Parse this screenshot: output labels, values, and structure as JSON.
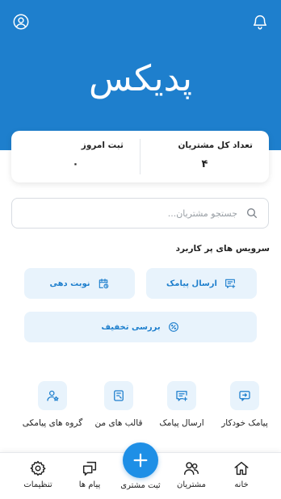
{
  "colors": {
    "primary": "#1e7fcd",
    "accent_bg": "#e8f3fc",
    "fab": "#1e8fe6"
  },
  "header": {
    "brand": "پدیکس",
    "bell_icon": "bell-icon",
    "profile_icon": "user-circle-icon"
  },
  "stats": {
    "total_customers_label": "تعداد کل مشتریان",
    "total_customers_value": "۴",
    "today_label": "ثبت امروز",
    "today_value": "۰"
  },
  "search": {
    "placeholder": "جستجو مشتریان..."
  },
  "services": {
    "title": "سرویس های پر کاربرد",
    "send_sms": "ارسال پیامک",
    "appointment": "نوبت دهی",
    "discount": "بررسی تخفیف"
  },
  "tiles": [
    {
      "label": "پیامک خودکار",
      "icon": "auto-message-icon"
    },
    {
      "label": "ارسال پیامک",
      "icon": "send-message-icon"
    },
    {
      "label": "قالب های من",
      "icon": "template-icon"
    },
    {
      "label": "گروه های پیامکی",
      "icon": "group-star-icon"
    }
  ],
  "nav": {
    "home": "خانه",
    "customers": "مشتریان",
    "add_customer": "ثبت مشتری",
    "messages": "پیام ها",
    "settings": "تنظیمات"
  }
}
